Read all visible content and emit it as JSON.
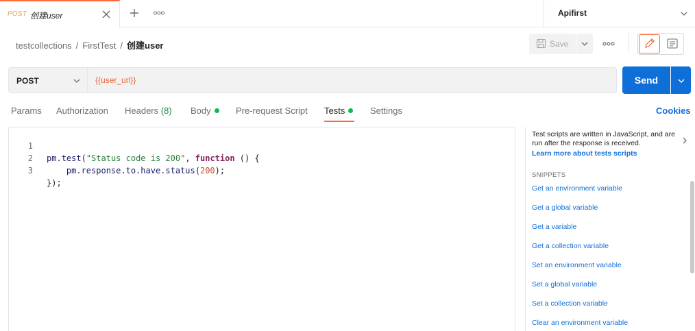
{
  "tab": {
    "method": "POST",
    "title": "创建user"
  },
  "environment": {
    "label": "Apifirst"
  },
  "breadcrumb": {
    "collection": "testcollections",
    "request_folder": "FirstTest",
    "current": "创建user"
  },
  "toolbar": {
    "save_label": "Save"
  },
  "request": {
    "method": "POST",
    "url": "{{user_url}}",
    "send_label": "Send"
  },
  "request_tabs": {
    "params": "Params",
    "authorization": "Authorization",
    "headers": "Headers",
    "headers_count": "(8)",
    "body": "Body",
    "pre_request": "Pre-request Script",
    "tests": "Tests",
    "settings": "Settings",
    "cookies": "Cookies"
  },
  "editor": {
    "line_numbers": [
      "1",
      "2",
      "3"
    ],
    "line1": {
      "obj": "pm",
      "dot1": ".",
      "fn": "test",
      "open": "(",
      "str": "\"Status code is 200\"",
      "comma": ", ",
      "kw": "function",
      "rest": " () {"
    },
    "line2": {
      "pre": "    pm.response.to.have.status(",
      "num": "200",
      "post": ");"
    },
    "line3": {
      "text": "});"
    }
  },
  "panel": {
    "description": "Test scripts are written in JavaScript, and are run after the response is received.",
    "learn_more": "Learn more about tests scripts",
    "snippets_heading": "SNIPPETS",
    "snippets": [
      "Get an environment variable",
      "Get a global variable",
      "Get a variable",
      "Get a collection variable",
      "Set an environment variable",
      "Set a global variable",
      "Set a collection variable",
      "Clear an environment variable"
    ]
  },
  "colors": {
    "accent": "#ff6c37",
    "primary": "#0f6fd9",
    "status_dot": "#0cbb52"
  },
  "icons": [
    "close-icon",
    "plus-icon",
    "more-icon",
    "chevron-down-icon",
    "save-icon",
    "pencil-icon",
    "document-icon",
    "chevron-right-icon"
  ]
}
